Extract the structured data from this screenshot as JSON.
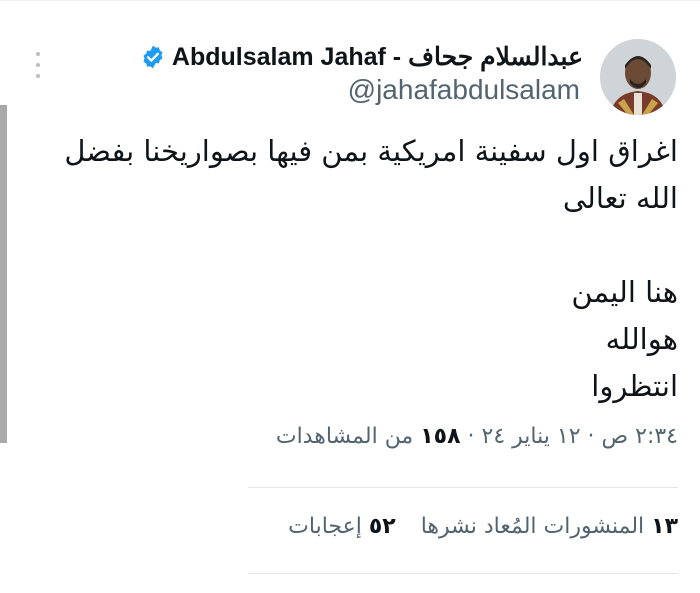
{
  "author": {
    "display_name": "عبدالسلام جحاف - Abdulsalam Jahaf",
    "handle": "@jahafabdulsalam",
    "verified": true,
    "verified_color": "#1d9bf0"
  },
  "tweet": {
    "lines": [
      "اغراق اول سفينة امريكية بمن فيها بصواريخنا بفضل",
      "الله تعالى",
      "",
      "هنا اليمن",
      "هوالله",
      "انتظروا"
    ]
  },
  "meta": {
    "time": "٢:٣٤ ص",
    "separator_1": "·",
    "date": "١٢ يناير ٢٤",
    "separator_2": "·",
    "views_count": "١٥٨",
    "views_label": "من المشاهدات"
  },
  "stats": {
    "reposts_count": "١٣",
    "reposts_label": "المنشورات المُعاد نشرها",
    "likes_count": "٥٢",
    "likes_label": "إعجابات"
  },
  "icons": {
    "more": "more-vertical-icon",
    "verified": "verified-badge-icon"
  },
  "colors": {
    "text_primary": "#0f1419",
    "text_secondary": "#536471",
    "divider": "#e3e7ea"
  }
}
